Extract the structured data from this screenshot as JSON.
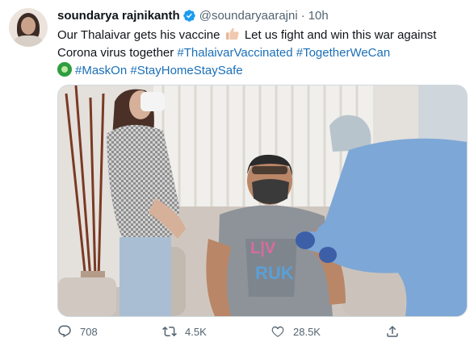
{
  "tweet": {
    "author_name": "soundarya rajnikanth",
    "handle": "@soundaryaarajni",
    "separator": "·",
    "time": "10h",
    "text_line1": "Our Thalaivar gets his vaccine",
    "text_line1b": "Let us fight and win this war against",
    "text_line2": "Corona virus together",
    "hashtag1": "#ThalaivarVaccinated",
    "hashtag2": "#TogetherWeCan",
    "hashtag3": "#MaskOn",
    "hashtag4": "#StayHomeStaySafe",
    "more_label": "···"
  },
  "icons": {
    "verified": "verified-badge-icon",
    "thumb": "thumbs-up-emoji",
    "vaccine": "microbe-emoji"
  },
  "colors": {
    "verified": "#1d9bf0",
    "hashtag": "#1b6fb8",
    "muted": "#536471"
  },
  "stats": {
    "replies": "708",
    "retweets": "4.5K",
    "likes": "28.5K"
  }
}
